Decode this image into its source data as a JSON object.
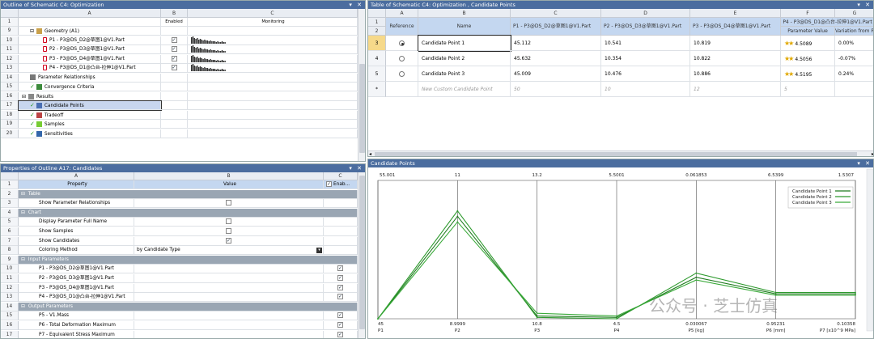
{
  "outline": {
    "title": "Outline of Schematic C4: Optimization",
    "col_a": "A",
    "col_b": "B",
    "col_c": "C",
    "h_enabled": "Enabled",
    "h_monitoring": "Monitoring",
    "rows": [
      {
        "num": "1",
        "label": "",
        "indent": 0
      },
      {
        "num": "9",
        "label": "Geometry (A1)",
        "indent": 1
      },
      {
        "num": "10",
        "label": "P1 - P3@DS_D2@草图1@V1.Part",
        "indent": 2
      },
      {
        "num": "11",
        "label": "P2 - P3@DS_D3@草图1@V1.Part",
        "indent": 2
      },
      {
        "num": "12",
        "label": "P3 - P3@DS_D4@草图1@V1.Part",
        "indent": 2
      },
      {
        "num": "13",
        "label": "P4 - P3@DS_D1@凸台-拉伸1@V1.Part",
        "indent": 2
      },
      {
        "num": "14",
        "label": "Parameter Relationships",
        "indent": 1
      },
      {
        "num": "15",
        "label": "Convergence Criteria",
        "indent": 1
      },
      {
        "num": "16",
        "label": "Results",
        "indent": 0
      },
      {
        "num": "17",
        "label": "Candidate Points",
        "indent": 1
      },
      {
        "num": "18",
        "label": "Tradeoff",
        "indent": 1
      },
      {
        "num": "19",
        "label": "Samples",
        "indent": 1
      },
      {
        "num": "20",
        "label": "Sensitivities",
        "indent": 1
      }
    ]
  },
  "props": {
    "title": "Properties of Outline A17: Candidates",
    "col_a": "A",
    "col_b": "B",
    "col_c": "C",
    "h_property": "Property",
    "h_value": "Value",
    "h_enab": "Enab...",
    "rows": [
      {
        "num": "1",
        "type": "hdr"
      },
      {
        "num": "2",
        "type": "sec",
        "label": "Table"
      },
      {
        "num": "3",
        "type": "prop",
        "label": "Show Parameter Relationships",
        "check": "empty"
      },
      {
        "num": "4",
        "type": "sec",
        "label": "Chart"
      },
      {
        "num": "5",
        "type": "prop",
        "label": "Display Parameter Full Name",
        "check": "empty"
      },
      {
        "num": "6",
        "type": "prop",
        "label": "Show Samples",
        "check": "empty"
      },
      {
        "num": "7",
        "type": "prop",
        "label": "Show Candidates",
        "check": "on"
      },
      {
        "num": "8",
        "type": "prop",
        "label": "Coloring Method",
        "value": "by Candidate Type"
      },
      {
        "num": "9",
        "type": "sec",
        "label": "Input Parameters"
      },
      {
        "num": "10",
        "type": "prop",
        "label": "P1 - P3@DS_D2@草图1@V1.Part",
        "enab": "on"
      },
      {
        "num": "11",
        "type": "prop",
        "label": "P2 - P3@DS_D3@草图1@V1.Part",
        "enab": "on"
      },
      {
        "num": "12",
        "type": "prop",
        "label": "P3 - P3@DS_D4@草图1@V1.Part",
        "enab": "on"
      },
      {
        "num": "13",
        "type": "prop",
        "label": "P4 - P3@DS_D1@凸台-拉伸1@V1.Part",
        "enab": "on"
      },
      {
        "num": "14",
        "type": "sec",
        "label": "Output Parameters"
      },
      {
        "num": "15",
        "type": "prop",
        "label": "P5 - V1.Mass",
        "enab": "on"
      },
      {
        "num": "16",
        "type": "prop",
        "label": "P6 - Total Deformation Maximum",
        "enab": "on"
      },
      {
        "num": "17",
        "type": "prop",
        "label": "P7 - Equivalent Stress Maximum",
        "enab": "on"
      }
    ]
  },
  "table": {
    "title": "Table of Schematic C4: Optimization , Candidate Points",
    "cols": [
      "A",
      "B",
      "C",
      "D",
      "E",
      "F",
      "G"
    ],
    "h_reference": "Reference",
    "h_name": "Name",
    "h_p1": "P1 - P3@DS_D2@草图1@V1.Part",
    "h_p2": "P2 - P3@DS_D3@草图1@V1.Part",
    "h_p3": "P3 - P3@DS_D4@草图1@V1.Part",
    "h_p4": "P4 - P3@DS_D1@凸台-拉伸1@V1.Part",
    "h_param_value": "Parameter Value",
    "h_variation": "Variation from Ref",
    "rows": [
      {
        "num": "3",
        "ref": "on",
        "name": "Candidate Point 1",
        "p1": "45.112",
        "p2": "10.541",
        "p3": "10.819",
        "p4": "4.5089",
        "var": "0.00%"
      },
      {
        "num": "4",
        "ref": "off",
        "name": "Candidate Point 2",
        "p1": "45.632",
        "p2": "10.354",
        "p3": "10.822",
        "p4": "4.5056",
        "var": "-0.07%"
      },
      {
        "num": "5",
        "ref": "off",
        "name": "Candidate Point 3",
        "p1": "45.009",
        "p2": "10.476",
        "p3": "10.886",
        "p4": "4.5195",
        "var": "0.24%"
      },
      {
        "num": "*",
        "ref": "none",
        "name": "New Custom Candidate Point",
        "p1": "50",
        "p2": "10",
        "p3": "12",
        "p4": "5",
        "var": ""
      }
    ]
  },
  "chart": {
    "title": "Candidate Points",
    "top_ticks": [
      "55.001",
      "11",
      "13.2",
      "5.5001",
      "0.061853",
      "6.5399",
      "1.5307"
    ],
    "bottom_values": [
      "45",
      "8.9999",
      "10.8",
      "4.5",
      "0.030067",
      "0.95231",
      "0.10358"
    ],
    "bottom_labels": [
      "P1",
      "P2",
      "P3",
      "P4",
      "P5 [kg]",
      "P6 [mm]",
      "P7 [x10^9 MPa]"
    ],
    "legend": [
      "Candidate Point 1",
      "Candidate Point 2",
      "Candidate Point 3"
    ],
    "color": "#2e8b2e"
  },
  "chart_data": {
    "type": "line",
    "categories": [
      "P1",
      "P2",
      "P3",
      "P4",
      "P5 [kg]",
      "P6 [mm]",
      "P7 [x10^9 MPa]"
    ],
    "series": [
      {
        "name": "Candidate Point 1",
        "values": [
          0.0,
          0.74,
          0.02,
          0.01,
          0.3,
          0.18,
          0.18
        ]
      },
      {
        "name": "Candidate Point 2",
        "values": [
          0.0,
          0.78,
          0.01,
          0.0,
          0.33,
          0.19,
          0.19
        ]
      },
      {
        "name": "Candidate Point 3",
        "values": [
          0.0,
          0.7,
          0.04,
          0.02,
          0.28,
          0.17,
          0.17
        ]
      }
    ],
    "ylim": [
      0,
      1
    ],
    "legend_position": "top-right"
  },
  "watermark": "公众号 · 芝士仿真"
}
